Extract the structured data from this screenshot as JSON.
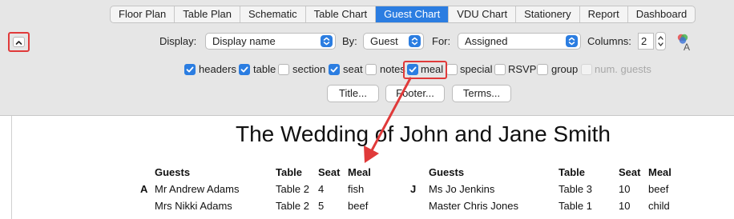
{
  "tabs": [
    "Floor Plan",
    "Table Plan",
    "Schematic",
    "Table Chart",
    "Guest Chart",
    "VDU Chart",
    "Stationery",
    "Report",
    "Dashboard"
  ],
  "active_tab": "Guest Chart",
  "controls": {
    "display_label": "Display:",
    "display_value": "Display name",
    "by_label": "By:",
    "by_value": "Guest",
    "for_label": "For:",
    "for_value": "Assigned",
    "columns_label": "Columns:",
    "columns_value": "2"
  },
  "checkboxes": [
    {
      "label": "headers",
      "checked": true
    },
    {
      "label": "table",
      "checked": true
    },
    {
      "label": "section",
      "checked": false
    },
    {
      "label": "seat",
      "checked": true
    },
    {
      "label": "notes",
      "checked": false
    },
    {
      "label": "meal",
      "checked": true
    },
    {
      "label": "special",
      "checked": false
    },
    {
      "label": "RSVP",
      "checked": false
    },
    {
      "label": "group",
      "checked": false
    },
    {
      "label": "num. guests",
      "checked": false,
      "disabled": true
    }
  ],
  "buttons": {
    "title": "Title...",
    "footer": "Footer...",
    "terms": "Terms..."
  },
  "document": {
    "title": "The Wedding of John and Jane Smith",
    "headers": {
      "guests": "Guests",
      "table": "Table",
      "seat": "Seat",
      "meal": "Meal"
    },
    "left": {
      "letter": "A",
      "rows": [
        {
          "guest": "Mr Andrew Adams",
          "table": "Table 2",
          "seat": "4",
          "meal": "fish"
        },
        {
          "guest": "Mrs Nikki Adams",
          "table": "Table 2",
          "seat": "5",
          "meal": "beef"
        }
      ]
    },
    "right": {
      "letter": "J",
      "rows": [
        {
          "guest": "Ms Jo Jenkins",
          "table": "Table 3",
          "seat": "10",
          "meal": "beef"
        },
        {
          "guest": "Master Chris Jones",
          "table": "Table 1",
          "seat": "10",
          "meal": "child"
        }
      ]
    }
  },
  "colors": {
    "accent": "#2b7de1",
    "annotation": "#e03a3a"
  }
}
